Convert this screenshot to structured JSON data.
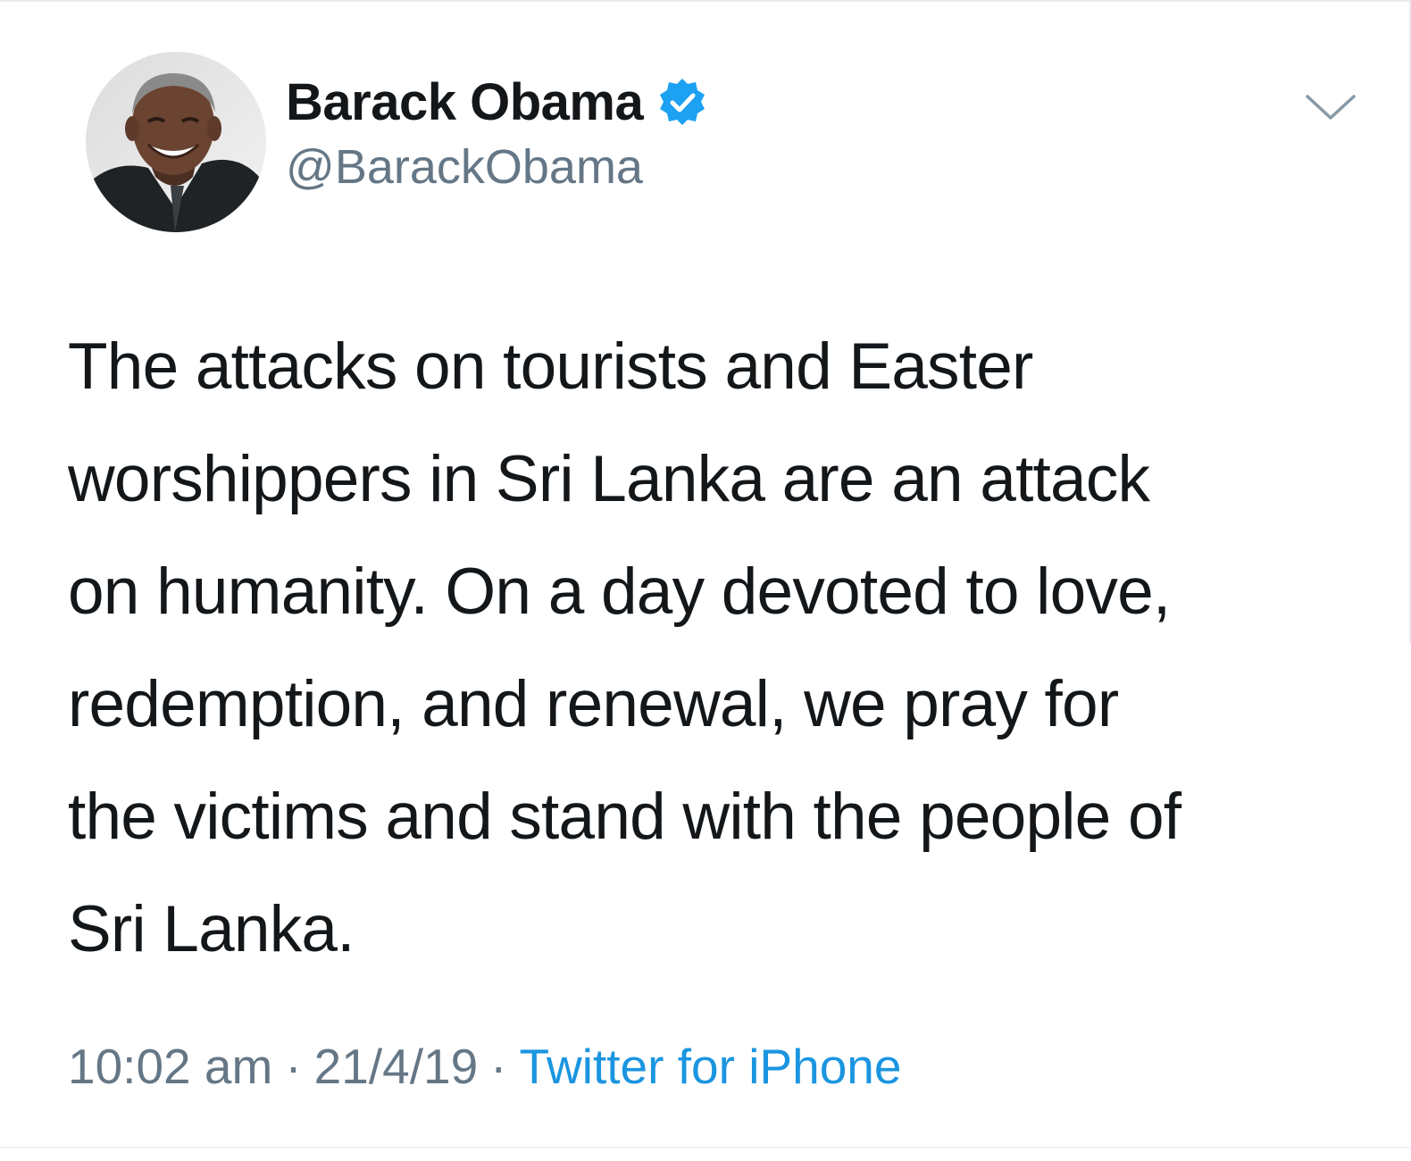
{
  "colors": {
    "text": "#14171a",
    "secondary": "#657786",
    "link": "#1b95e0",
    "verified": "#1da1f2"
  },
  "author": {
    "display_name": "Barack Obama",
    "handle": "@BarackObama",
    "verified_icon": "verified-badge-icon",
    "avatar": "profile-photo"
  },
  "menu_icon": "chevron-down-icon",
  "tweet": {
    "text": "The attacks on tourists and Easter\nworshippers in Sri Lanka are an attack\non humanity. On a day devoted to love,\nredemption, and renewal, we pray for\nthe victims and stand with the people of\nSri Lanka.",
    "time": "10:02 am",
    "separator": "·",
    "date": "21/4/19",
    "source": "Twitter for iPhone"
  }
}
